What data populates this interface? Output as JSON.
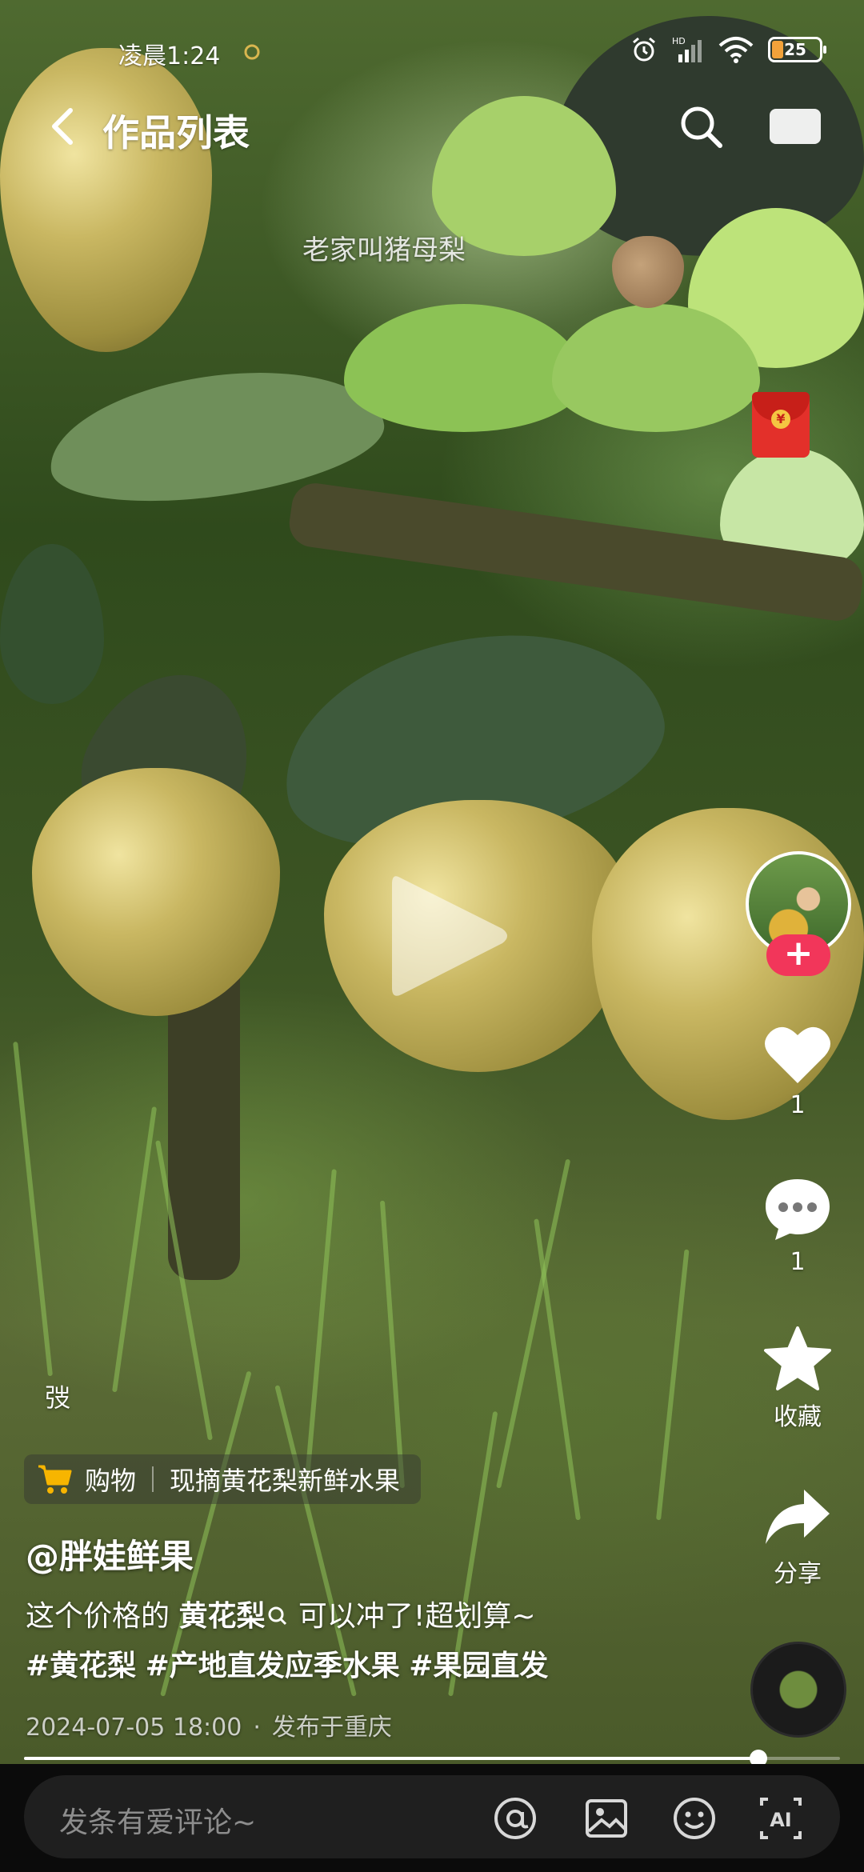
{
  "status_bar": {
    "time": "凌晨1:24",
    "network": "HD",
    "battery": "25",
    "icons": [
      "alarm-icon",
      "signal-icon",
      "wifi-icon",
      "battery-icon"
    ]
  },
  "header": {
    "title": "作品列表",
    "back_icon": "back-arrow-icon",
    "search_icon": "search-icon",
    "screen_icon": "cast-screen-icon"
  },
  "video": {
    "caption": "老家叫猪母梨",
    "playing": false,
    "progress": 0.9
  },
  "red_packet": {
    "symbol": "¥"
  },
  "rail": {
    "follow_label": "+",
    "like_count": "1",
    "comment_count": "1",
    "favorite_label": "收藏",
    "share_label": "分享"
  },
  "post": {
    "side_label": "弢",
    "shop_label": "购物",
    "shop_product": "现摘黄花梨新鲜水果",
    "author": "@胖娃鲜果",
    "desc_prefix": "这个价格的 ",
    "desc_keyword": "黄花梨",
    "desc_suffix": " 可以冲了!超划算~",
    "tag_1": "#黄花梨",
    "tag_2": "#产地直发应季水果",
    "tag_3": "#果园直发",
    "date": "2024-07-05 18:00",
    "separator": "·",
    "location": "发布于重庆"
  },
  "comment_bar": {
    "placeholder": "发条有爱评论~",
    "icons": [
      "at-icon",
      "image-icon",
      "emoji-icon",
      "ai-icon"
    ],
    "ai_label": "AI"
  },
  "colors": {
    "accent_red": "#f2365a",
    "shop_cart": "#f7b500",
    "comment_bg": "#0b0b0b"
  }
}
